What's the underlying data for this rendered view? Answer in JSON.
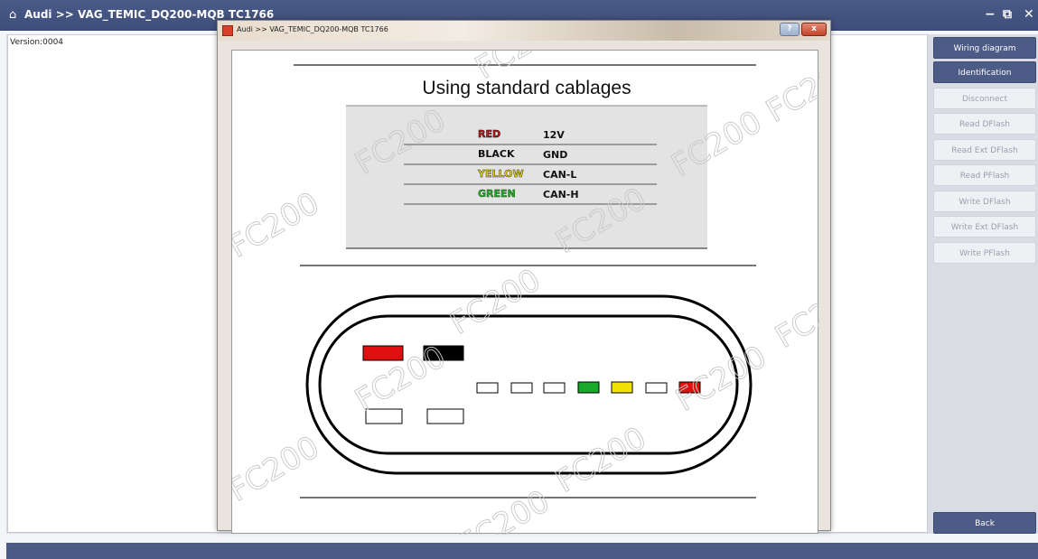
{
  "window": {
    "title": "Audi >> VAG_TEMIC_DQ200-MQB TC1766",
    "home_icon": "home-icon",
    "controls": {
      "minimize": "−",
      "restore": "⧉",
      "close": "✕"
    }
  },
  "version_label": "Version:0004",
  "dialog": {
    "title": "Audi >> VAG_TEMIC_DQ200-MQB TC1766",
    "help_label": "?",
    "close_label": "x",
    "heading": "Using standard cablages",
    "wires": [
      {
        "color_name": "RED",
        "signal": "12V",
        "color": "#c81e1e"
      },
      {
        "color_name": "BLACK",
        "signal": "GND",
        "color": "#111111"
      },
      {
        "color_name": "YELLOW",
        "signal": "CAN-L",
        "color": "#e6d400"
      },
      {
        "color_name": "GREEN",
        "signal": "CAN-H",
        "color": "#28a82a"
      }
    ],
    "watermark": "FC200"
  },
  "sidebar": {
    "buttons": [
      {
        "label": "Wiring diagram",
        "enabled": true
      },
      {
        "label": "Identification",
        "enabled": true
      },
      {
        "label": "Disconnect",
        "enabled": false
      },
      {
        "label": "Read DFlash",
        "enabled": false
      },
      {
        "label": "Read Ext DFlash",
        "enabled": false
      },
      {
        "label": "Read PFlash",
        "enabled": false
      },
      {
        "label": "Write DFlash",
        "enabled": false
      },
      {
        "label": "Write Ext DFlash",
        "enabled": false
      },
      {
        "label": "Write PFlash",
        "enabled": false
      }
    ],
    "back_label": "Back"
  },
  "colors": {
    "titlebar": "#44537f",
    "accent_button": "#4d5c86",
    "pin_red": "#e01010",
    "pin_black": "#000000",
    "pin_green": "#18a82a",
    "pin_yellow": "#f2e200"
  }
}
